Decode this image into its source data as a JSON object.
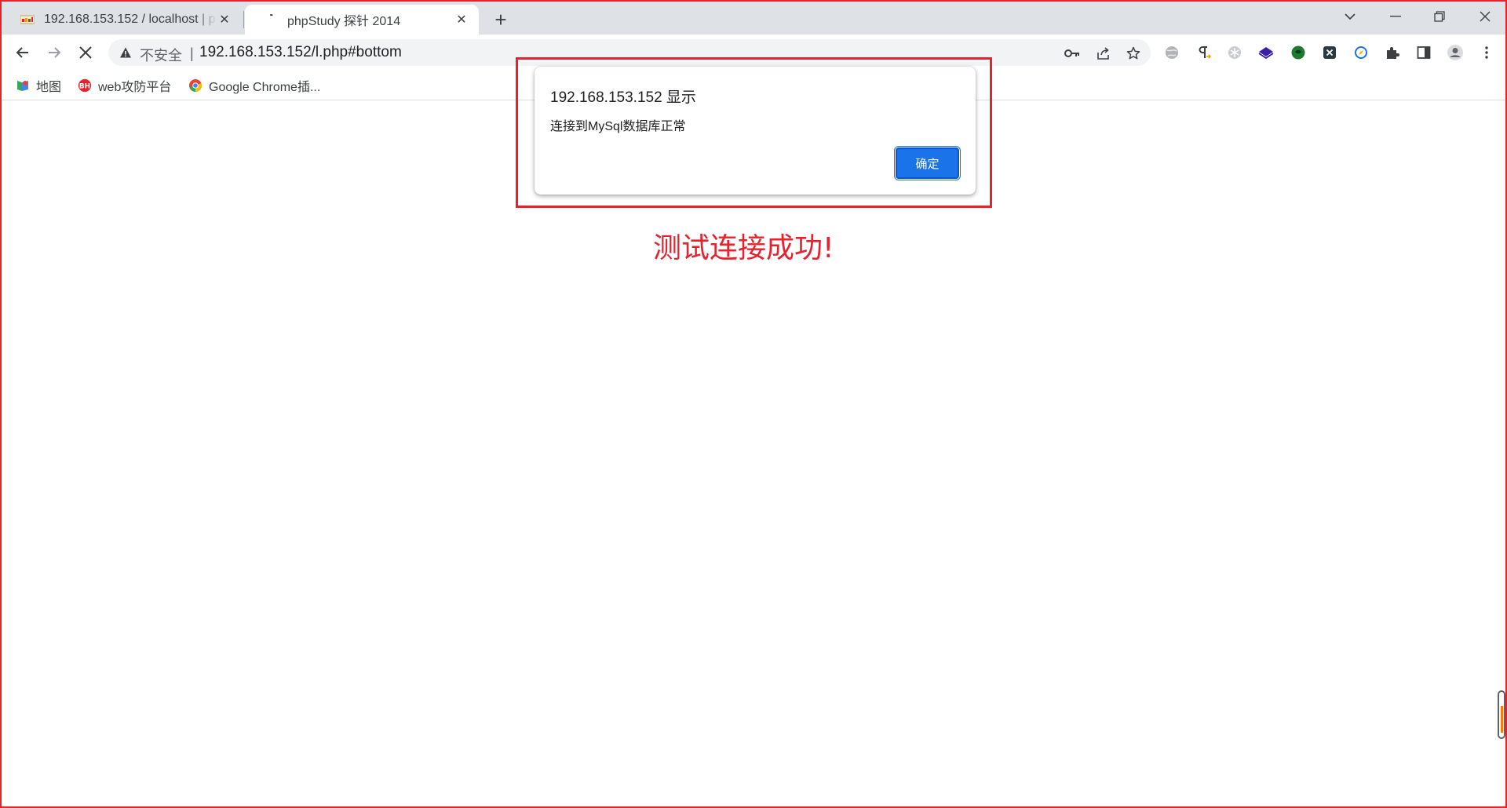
{
  "tabs": [
    {
      "title": "192.168.153.152 / localhost | p",
      "favicon": "phpmyadmin-icon",
      "active": false
    },
    {
      "title": "phpStudy 探针 2014",
      "favicon": "loading-icon",
      "active": true
    }
  ],
  "toolbar": {
    "security_label": "不安全",
    "separator": "|",
    "url": "192.168.153.152/l.php#bottom"
  },
  "bookmarks": [
    {
      "label": "地图",
      "icon": "maps-icon"
    },
    {
      "label": "web攻防平台",
      "icon": "bh-logo-icon"
    },
    {
      "label": "Google Chrome插...",
      "icon": "chrome-icon"
    }
  ],
  "dialog": {
    "title": "192.168.153.152 显示",
    "message": "连接到MySql数据库正常",
    "ok_label": "确定"
  },
  "page": {
    "success_text": "测试连接成功!"
  },
  "colors": {
    "annotation_red": "#e8222d",
    "chrome_blue": "#1a73e8",
    "tabstrip": "#dee1e6"
  }
}
